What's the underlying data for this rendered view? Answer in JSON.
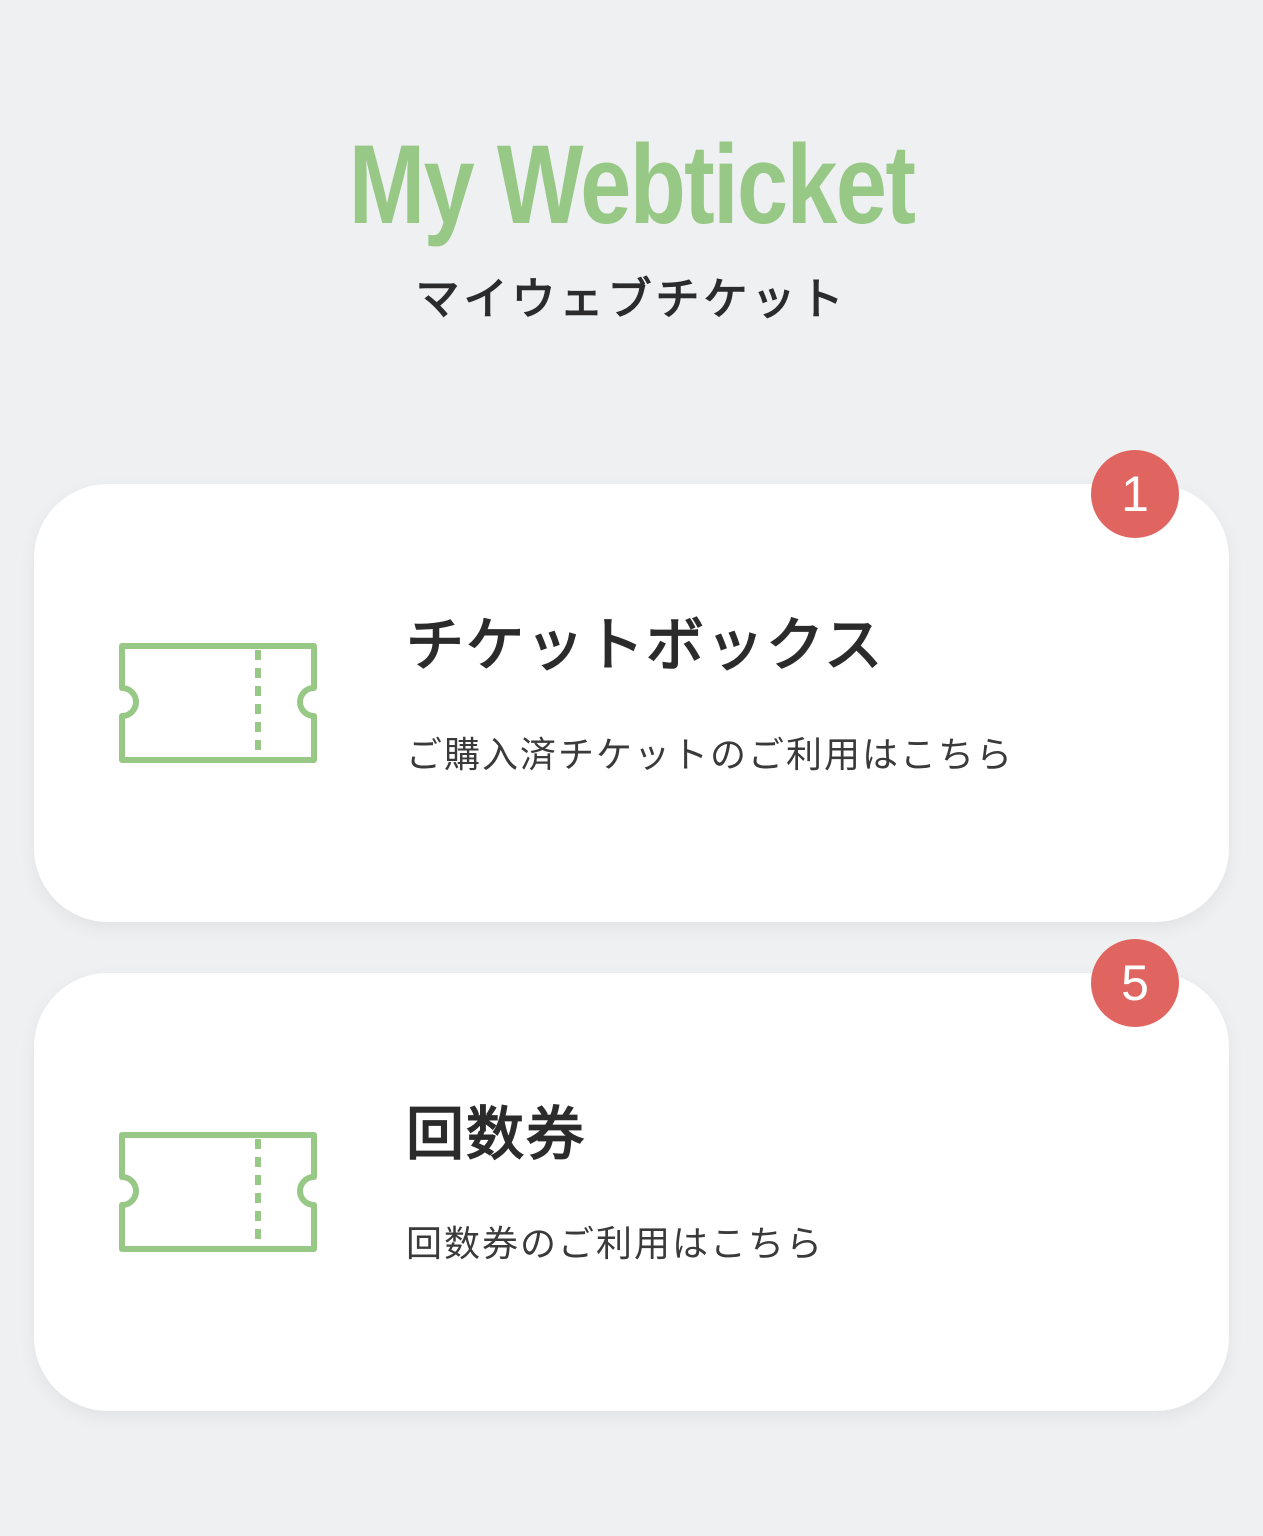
{
  "header": {
    "title": "My Webticket",
    "subtitle": "マイウェブチケット"
  },
  "cards": [
    {
      "title": "チケットボックス",
      "description": "ご購入済チケットのご利用はこちら",
      "badge": "1",
      "icon": "ticket-icon"
    },
    {
      "title": "回数券",
      "description": "回数券のご利用はこちら",
      "badge": "5",
      "icon": "ticket-icon"
    }
  ],
  "colors": {
    "accent": "#97c886",
    "badge": "#e06560",
    "background": "#eef0f2",
    "text": "#2b2b2b"
  }
}
